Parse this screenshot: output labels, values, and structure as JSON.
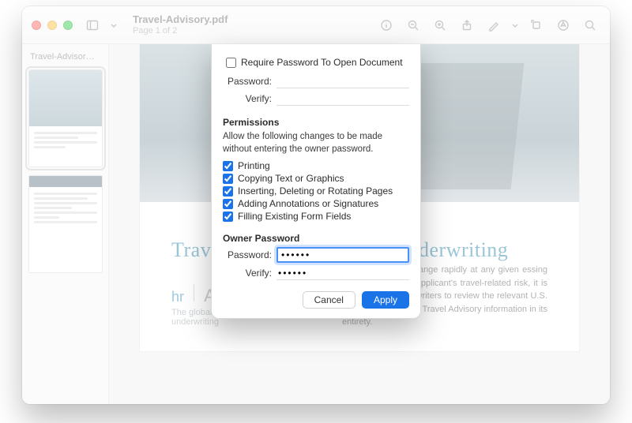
{
  "doc": {
    "filename": "Travel-Advisory.pdf",
    "page_label": "Page 1 of 2",
    "sidebar_label": "Travel-Advisor…"
  },
  "page": {
    "h1": "Travel Advisories & Life Underwriting",
    "brand_hr": "hr",
    "brand_asc": "Ascent",
    "tagline": "The global guide for life underwriting",
    "para": "in a country can change rapidly at any given essing and classifying an applicant's travel-related risk, it is important for underwriters to review the relevant U.S. Department of State Travel Advisory information in its entirety."
  },
  "sheet": {
    "require_label": "Require Password To Open Document",
    "password_label": "Password:",
    "verify_label": "Verify:",
    "open_password": "",
    "open_verify": "",
    "permissions_header": "Permissions",
    "permissions_text": "Allow the following changes to be made without entering the owner password.",
    "perms": [
      "Printing",
      "Copying Text or Graphics",
      "Inserting, Deleting or Rotating Pages",
      "Adding Annotations or Signatures",
      "Filling Existing Form Fields"
    ],
    "owner_header": "Owner Password",
    "owner_password": "••••••",
    "owner_verify": "••••••",
    "cancel": "Cancel",
    "apply": "Apply"
  }
}
